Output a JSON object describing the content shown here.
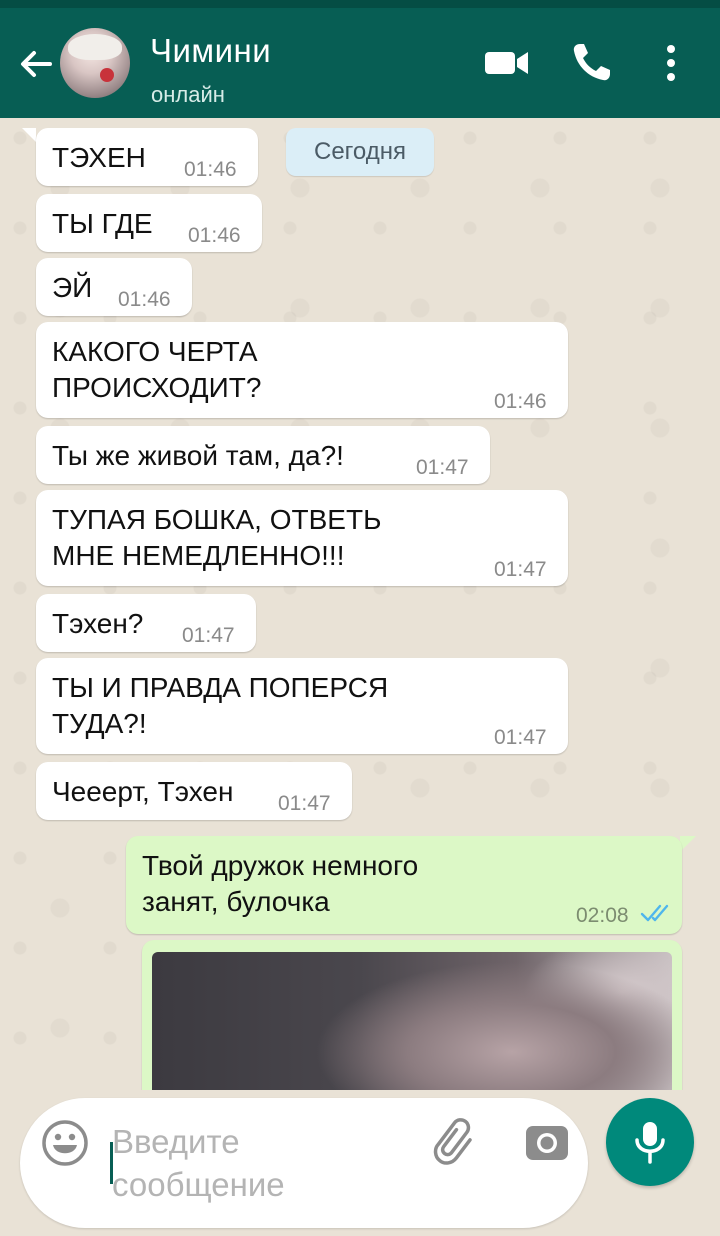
{
  "header": {
    "contact_name": "Чимини",
    "contact_status": "онлайн",
    "icons": [
      "back-arrow-icon",
      "video-call-icon",
      "phone-icon",
      "more-vertical-icon"
    ]
  },
  "chat": {
    "date_chip": "Сегодня",
    "messages": [
      {
        "direction": "in",
        "text": "ТЭХЕН",
        "time": "01:46"
      },
      {
        "direction": "in",
        "text": "ТЫ ГДЕ",
        "time": "01:46"
      },
      {
        "direction": "in",
        "text": "ЭЙ",
        "time": "01:46"
      },
      {
        "direction": "in",
        "text": "КАКОГО ЧЕРТА\nПРОИСХОДИТ?",
        "time": "01:46"
      },
      {
        "direction": "in",
        "text": "Ты же живой там, да?!",
        "time": "01:47"
      },
      {
        "direction": "in",
        "text": "ТУПАЯ БОШКА, ОТВЕТЬ\nМНЕ НЕМЕДЛЕННО!!!",
        "time": "01:47"
      },
      {
        "direction": "in",
        "text": "Тэхен?",
        "time": "01:47"
      },
      {
        "direction": "in",
        "text": "ТЫ И ПРАВДА ПОПЕРСЯ\nТУДА?!",
        "time": "01:47"
      },
      {
        "direction": "in",
        "text": "Чееерт, Тэхен",
        "time": "01:47"
      },
      {
        "direction": "out",
        "text": "Твой дружок немного\nзанят, булочка",
        "time": "02:08",
        "status": "read"
      }
    ]
  },
  "composer": {
    "placeholder": "Введите\nсообщение",
    "icons": [
      "emoji-icon",
      "attachment-icon",
      "camera-icon",
      "microphone-icon"
    ]
  },
  "colors": {
    "header": "#075e54",
    "outgoing_bubble": "#dcf8c6",
    "incoming_bubble": "#ffffff",
    "read_ticks": "#4fb6ec",
    "mic_button": "#00897b"
  }
}
